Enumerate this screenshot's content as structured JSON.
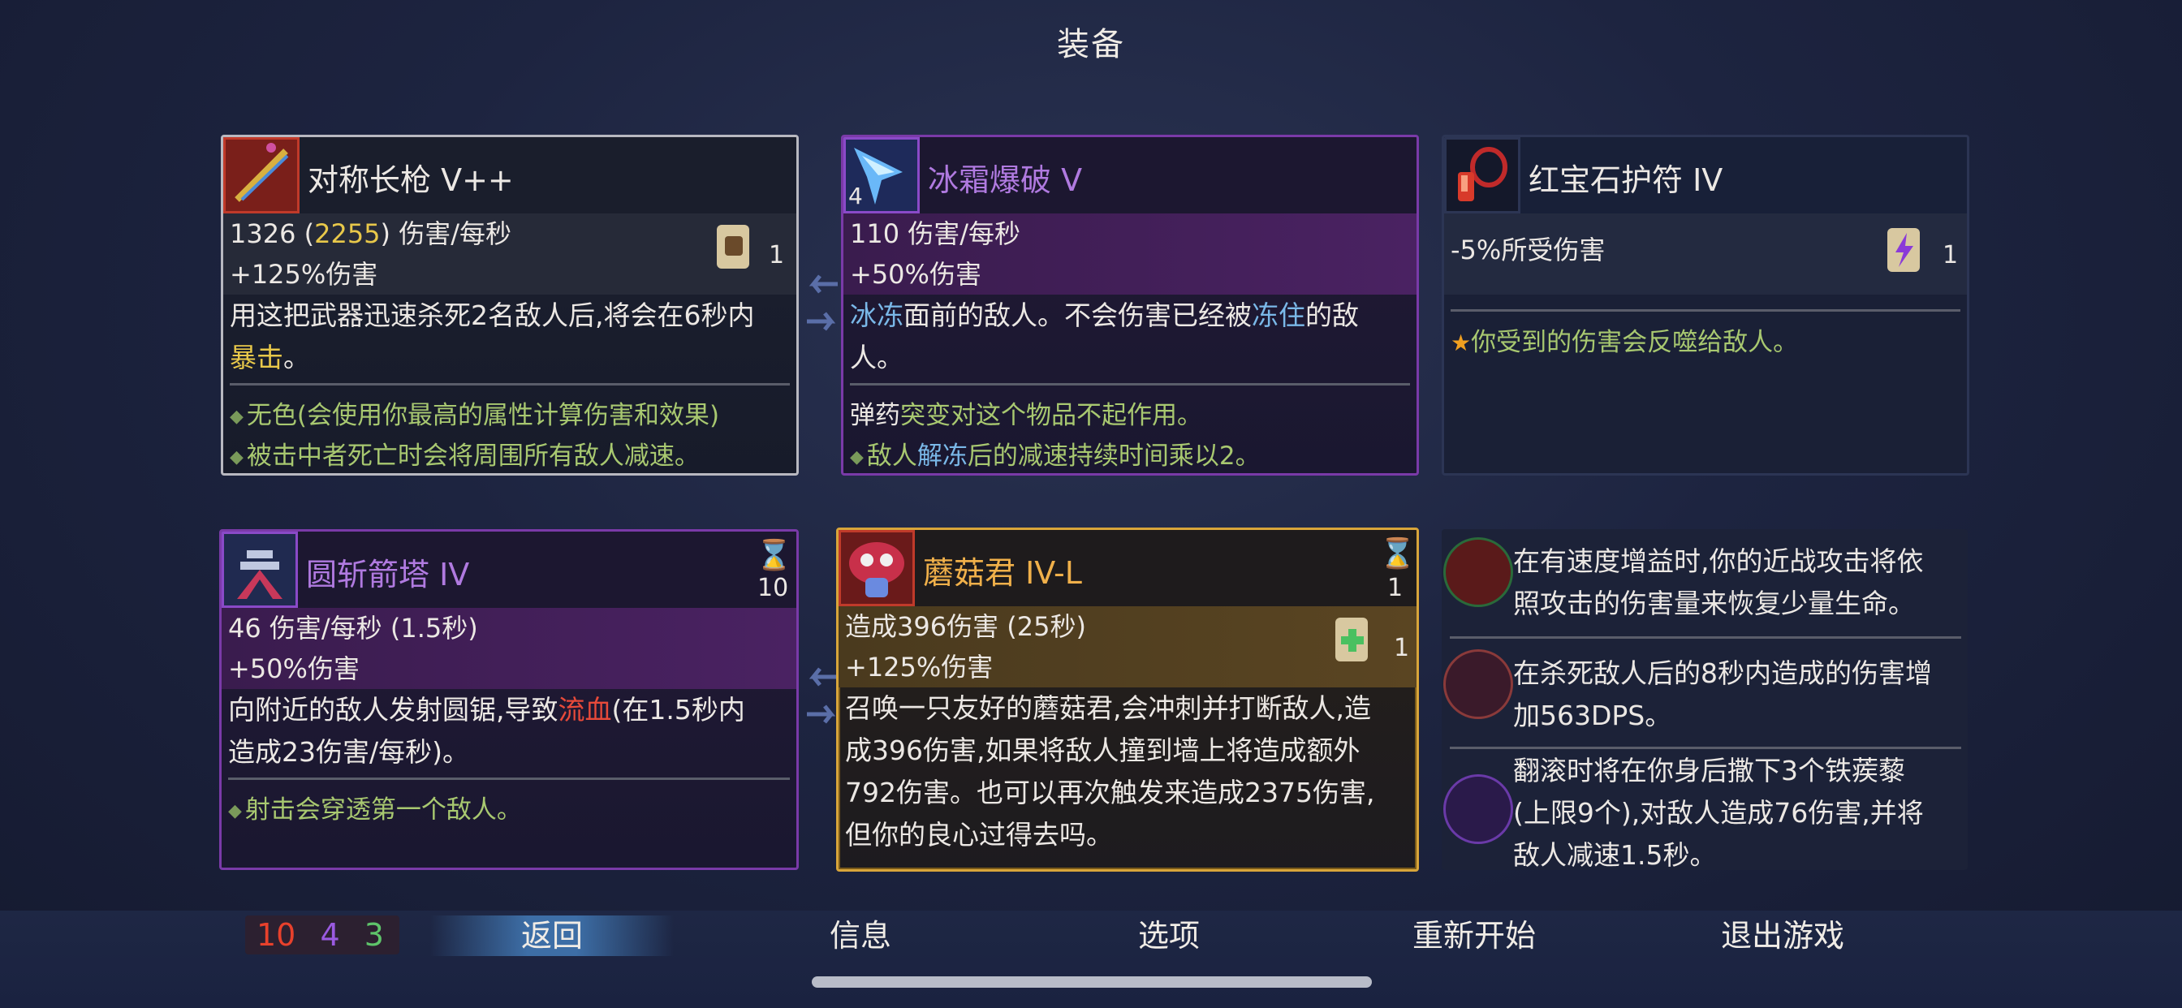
{
  "screen_title": "装备",
  "items": [
    {
      "name": "对称长枪 V++",
      "dps_main": "1326 (",
      "dps_alt": "2255",
      "dps_tail": ") 伤害/每秒",
      "bonus": "+125%伤害",
      "scroll_count": "1",
      "desc_1": "用这把武器迅速杀死2名敌人后,将会在6秒内",
      "desc_2": "暴击",
      "desc_3": "。",
      "bullets": [
        "无色(会使用你最高的属性计算伤害和效果)",
        "被击中者死亡时会将周围所有敌人减速。"
      ]
    },
    {
      "name": "冰霜爆破 V",
      "level_badge": "4",
      "dps": "110 伤害/每秒",
      "bonus": "+50%伤害",
      "desc_1a": "冰冻",
      "desc_1b": "面前的敌人。不会伤害已经被",
      "desc_1c": "冻住",
      "desc_1d": "的敌",
      "desc_2": "人。",
      "note_a": "弹药",
      "note_b": "突变对这个物品不起作用。",
      "bullet_a": "敌人",
      "bullet_b": "解冻",
      "bullet_c": "后的减速持续时间乘以2。"
    },
    {
      "name": "红宝石护符 IV",
      "stat": "-5%所受伤害",
      "scroll_count": "1",
      "effect": "你受到的伤害会反噬给敌人。"
    },
    {
      "name": "圆斩箭塔 IV",
      "charges": "10",
      "dps": "46 伤害/每秒 (1.5秒)",
      "bonus": "+50%伤害",
      "desc_1a": "向附近的敌人发射圆锯,导致",
      "desc_1b": "流血",
      "desc_1c": "(在1.5秒内",
      "desc_2": "造成23伤害/每秒)。",
      "bullet": "射击会穿透第一个敌人。"
    },
    {
      "name": "蘑菇君 IV-L",
      "charges": "1",
      "dps": "造成396伤害 (25秒)",
      "bonus": "+125%伤害",
      "scroll_count": "1",
      "desc": [
        "召唤一只友好的蘑菇君,会冲刺并打断敌人,造",
        "成396伤害,如果将敌人撞到墙上将造成额外",
        "792伤害。也可以再次触发来造成2375伤害,",
        "但你的良心过得去吗。"
      ]
    }
  ],
  "mutations": [
    {
      "text": [
        "在有速度增益时,你的近战攻击将依",
        "照攻击的伤害量来恢复少量生命。"
      ]
    },
    {
      "text": [
        "在杀死敌人后的8秒内造成的伤害增",
        "加563DPS。"
      ]
    },
    {
      "text": [
        "翻滚时将在你身后撒下3个铁蒺藜",
        "(上限9个),对敌人造成76伤害,并将",
        "敌人减速1.5秒。"
      ]
    }
  ],
  "stats": {
    "brutality": "10",
    "tactics": "4",
    "survival": "3"
  },
  "menu": {
    "back": "返回",
    "info": "信息",
    "options": "选项",
    "restart": "重新开始",
    "quit": "退出游戏"
  },
  "colors": {
    "brutality": "#e8412c",
    "tactics": "#9a5ae0",
    "survival": "#5ec46a",
    "highlight_yellow": "#e8c84a",
    "freeze_blue": "#7ab8e8",
    "bleed_red": "#e84a3a"
  }
}
